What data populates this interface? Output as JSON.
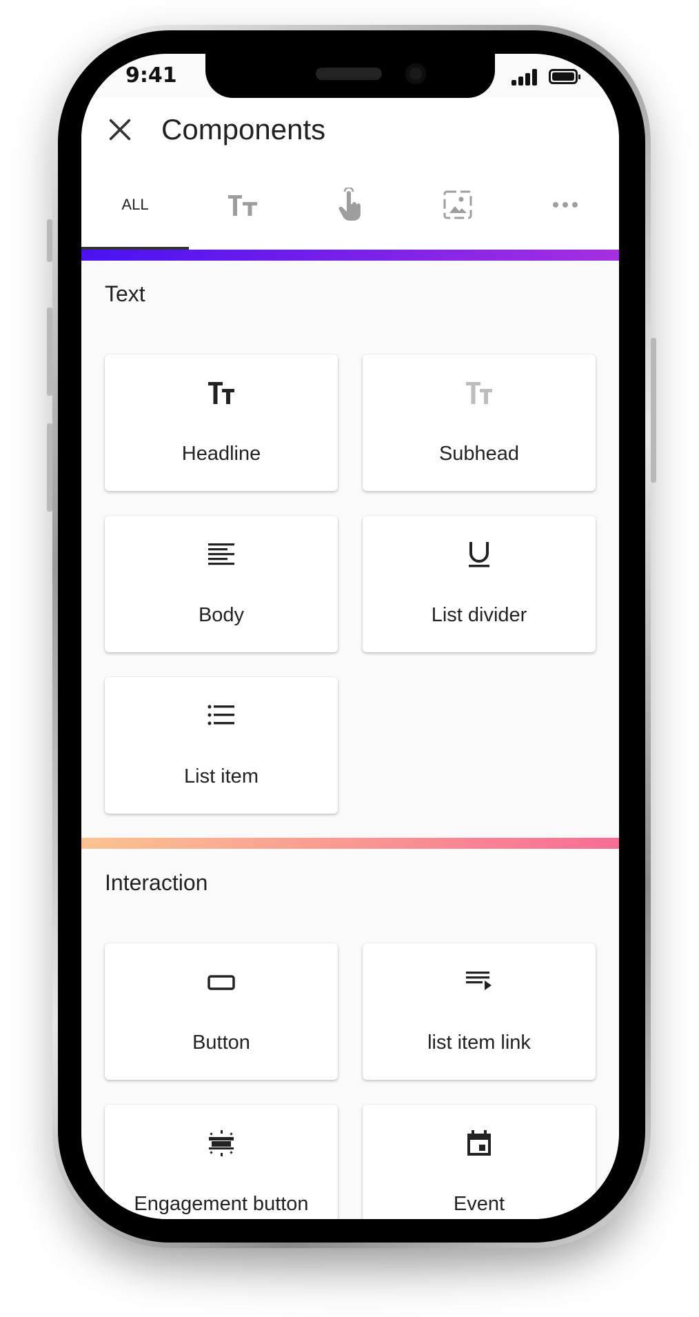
{
  "status_bar": {
    "time": "9:41"
  },
  "app_bar": {
    "title": "Components",
    "close_icon": "close-icon"
  },
  "tabs": [
    {
      "label": "ALL",
      "selected": true
    },
    {
      "icon": "text-format-icon"
    },
    {
      "icon": "touch-icon"
    },
    {
      "icon": "image-icon"
    },
    {
      "icon": "more-horiz-icon"
    }
  ],
  "sections": [
    {
      "title": "Text",
      "gradient": [
        "#4a12f0",
        "#a52fe0"
      ],
      "items": [
        {
          "label": "Headline",
          "icon": "headline-icon"
        },
        {
          "label": "Subhead",
          "icon": "subhead-icon"
        },
        {
          "label": "Body",
          "icon": "body-text-icon"
        },
        {
          "label": "List divider",
          "icon": "underline-icon"
        },
        {
          "label": "List item",
          "icon": "list-icon"
        }
      ]
    },
    {
      "title": "Interaction",
      "gradient": [
        "#fcc390",
        "#f76d94"
      ],
      "items": [
        {
          "label": "Button",
          "icon": "button-icon"
        },
        {
          "label": "list item link",
          "icon": "playlist-play-icon"
        },
        {
          "label": "Engagement button",
          "icon": "engagement-icon"
        },
        {
          "label": "Event",
          "icon": "event-icon"
        }
      ]
    }
  ]
}
